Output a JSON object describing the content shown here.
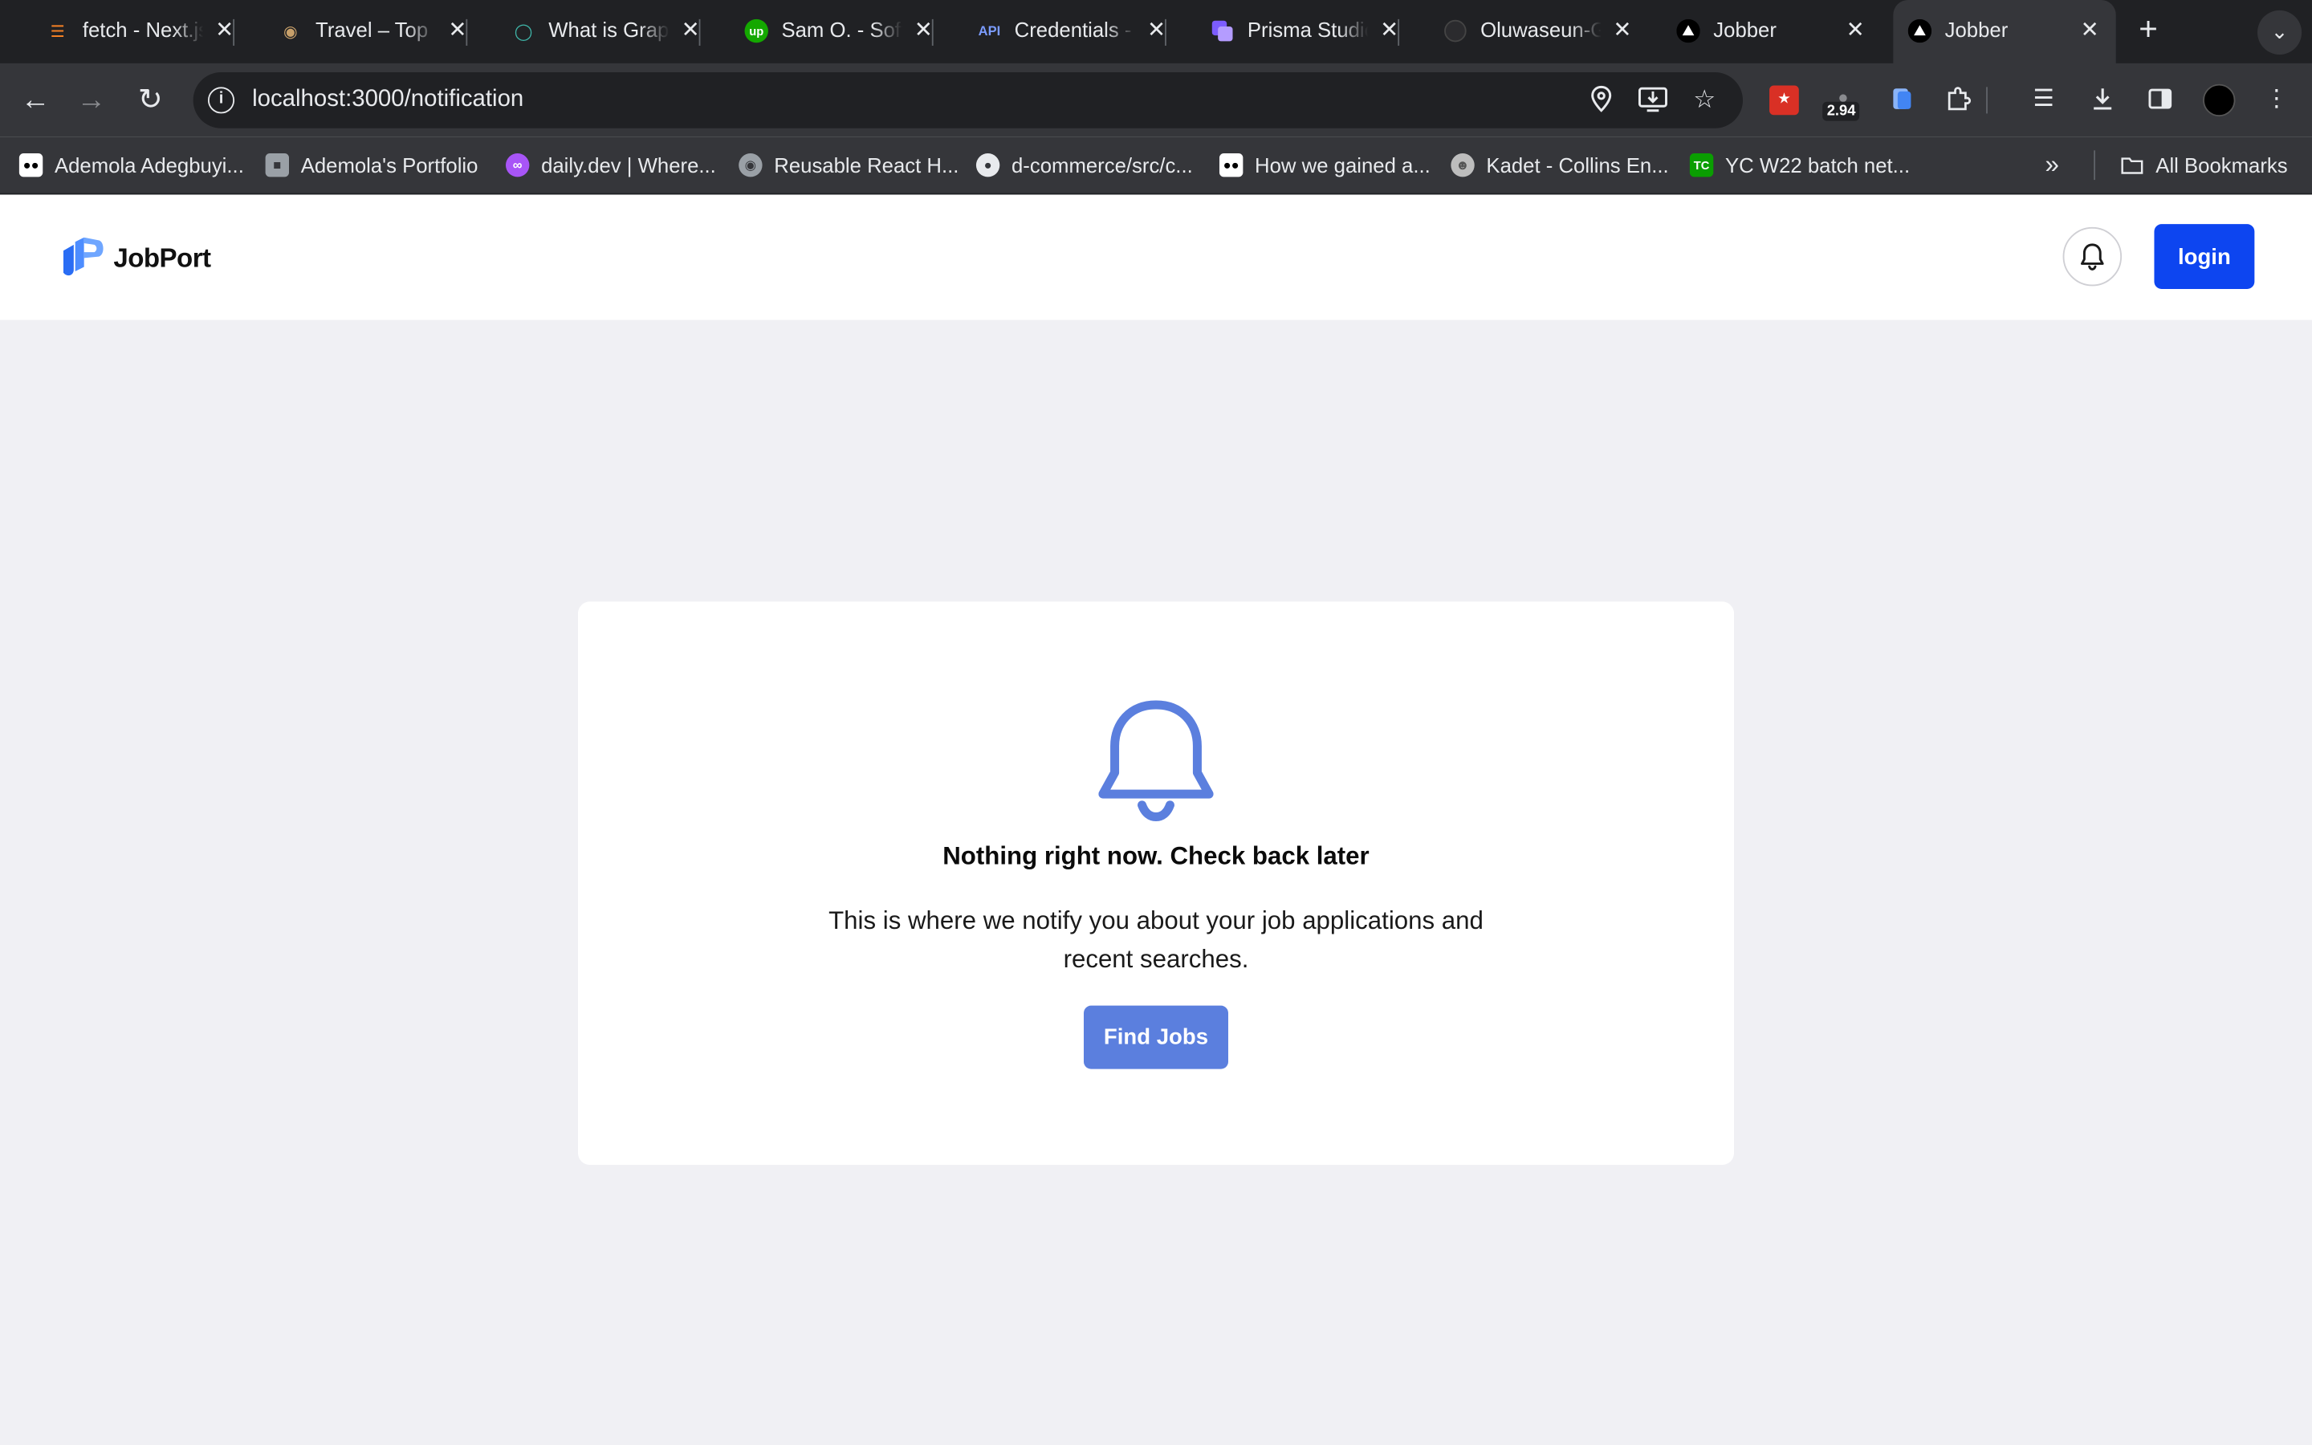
{
  "browser": {
    "tabs": [
      {
        "title": "fetch - Next.js",
        "favicon": "stackoverflow-icon",
        "active": false
      },
      {
        "title": "Travel – Top",
        "favicon": "travel-icon",
        "active": false
      },
      {
        "title": "What is GraphQL",
        "favicon": "eye-icon",
        "active": false
      },
      {
        "title": "Sam O. - Software",
        "favicon": "upwork-icon",
        "active": false
      },
      {
        "title": "Credentials - API",
        "favicon": "api-icon",
        "active": false
      },
      {
        "title": "Prisma Studio",
        "favicon": "prisma-icon",
        "active": false
      },
      {
        "title": "Oluwaseun-G",
        "favicon": "github-icon",
        "active": false
      },
      {
        "title": "Jobber",
        "favicon": "triangle-icon",
        "active": false
      },
      {
        "title": "Jobber",
        "favicon": "triangle-icon",
        "active": true
      }
    ],
    "address_bar": {
      "url": "localhost:3000/notification"
    },
    "extension_badge": "2.94",
    "bookmarks": [
      {
        "label": "Ademola Adegbuyi...",
        "icon": "medium-icon"
      },
      {
        "label": "Ademola's Portfolio",
        "icon": "portfolio-icon"
      },
      {
        "label": "daily.dev | Where...",
        "icon": "dailydev-icon"
      },
      {
        "label": "Reusable React H...",
        "icon": "globe-icon"
      },
      {
        "label": "d-commerce/src/c...",
        "icon": "github-icon"
      },
      {
        "label": "How we gained a...",
        "icon": "medium-icon"
      },
      {
        "label": "Kadet - Collins En...",
        "icon": "avatar-icon"
      },
      {
        "label": "YC W22 batch net...",
        "icon": "techcrunch-icon"
      }
    ],
    "all_bookmarks_label": "All Bookmarks"
  },
  "header": {
    "logo_text": "JobPort",
    "login_label": "login"
  },
  "empty_state": {
    "title": "Nothing right now. Check back later",
    "description": "This is where we notify you about your job applications and recent searches.",
    "cta_label": "Find Jobs"
  },
  "colors": {
    "primary": "#0d45f0",
    "accent": "#5b7fde",
    "page_bg": "#f0f0f4"
  }
}
